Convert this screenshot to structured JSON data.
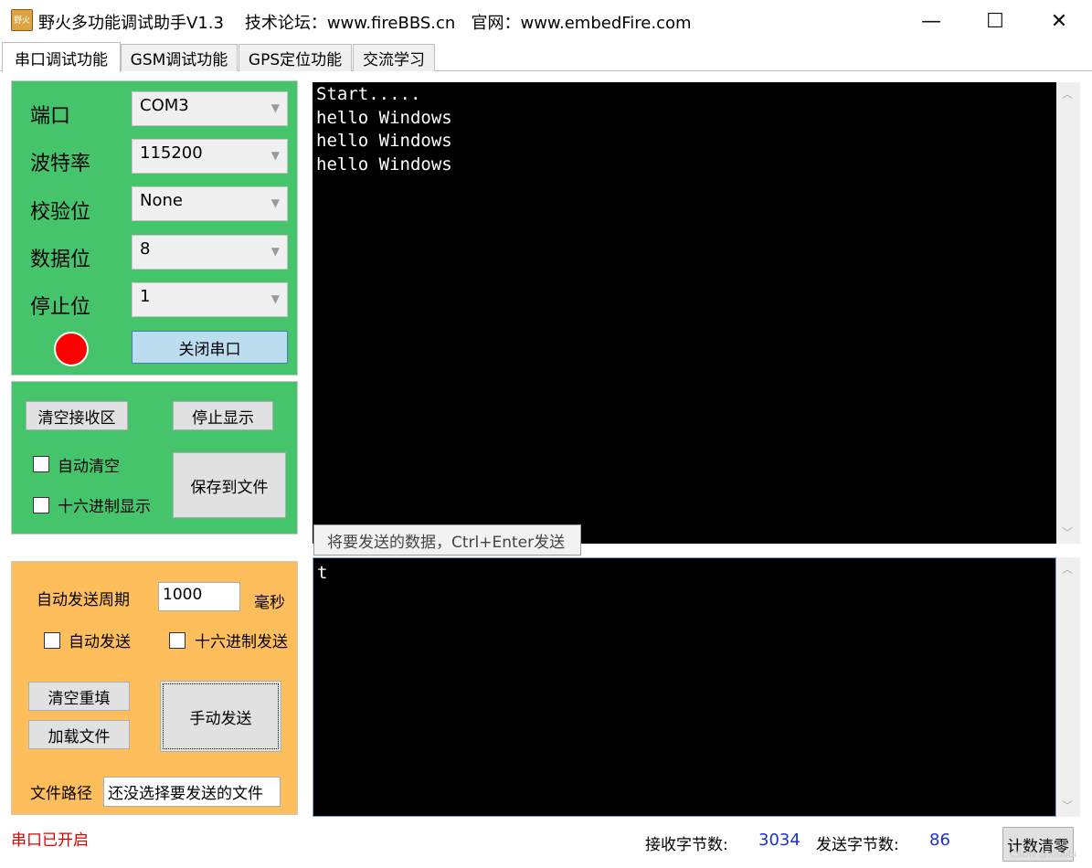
{
  "window": {
    "title": "野火多功能调试助手V1.3    技术论坛：www.fireBBS.cn   官网：www.embedFire.com",
    "icon_text": "野火",
    "minimize": "—",
    "maximize": "☐",
    "close": "✕"
  },
  "tabs": [
    {
      "label": "串口调试功能"
    },
    {
      "label": "GSM调试功能"
    },
    {
      "label": "GPS定位功能"
    },
    {
      "label": "交流学习"
    }
  ],
  "serial": {
    "port_label": "端口",
    "port_value": "COM3",
    "baud_label": "波特率",
    "baud_value": "115200",
    "parity_label": "校验位",
    "parity_value": "None",
    "databits_label": "数据位",
    "databits_value": "8",
    "stopbits_label": "停止位",
    "stopbits_value": "1",
    "indicator_color": "#ff0000",
    "close_port_button": "关闭串口"
  },
  "receive_panel": {
    "clear_button": "清空接收区",
    "stop_display_button": "停止显示",
    "auto_clear_label": "自动清空",
    "hex_display_label": "十六进制显示",
    "save_file_button": "保存到文件"
  },
  "send_panel": {
    "period_label": "自动发送周期",
    "period_value": "1000",
    "period_unit": "毫秒",
    "auto_send_label": "自动发送",
    "hex_send_label": "十六进制发送",
    "clear_refill_button": "清空重填",
    "load_file_button": "加载文件",
    "manual_send_button": "手动发送",
    "file_path_label": "文件路径",
    "file_path_value": "还没选择要发送的文件"
  },
  "receive_text": "Start.....\nhello Windows\nhello Windows\nhello Windows",
  "send_hint": "将要发送的数据，Ctrl+Enter发送",
  "send_text": "t",
  "status": {
    "port_state": "串口已开启",
    "port_state_color": "#e00000",
    "rx_label": "接收字节数:",
    "rx_value": "3034",
    "tx_label": "发送字节数:",
    "tx_value": "86",
    "count_color": "#1a2fd6",
    "reset_button": "计数清零",
    "watermark": "CSDN @Xiuubi"
  },
  "colors": {
    "green_panel": "#45c46c",
    "orange_panel": "#ffbe5c",
    "terminal_bg": "#000000"
  }
}
